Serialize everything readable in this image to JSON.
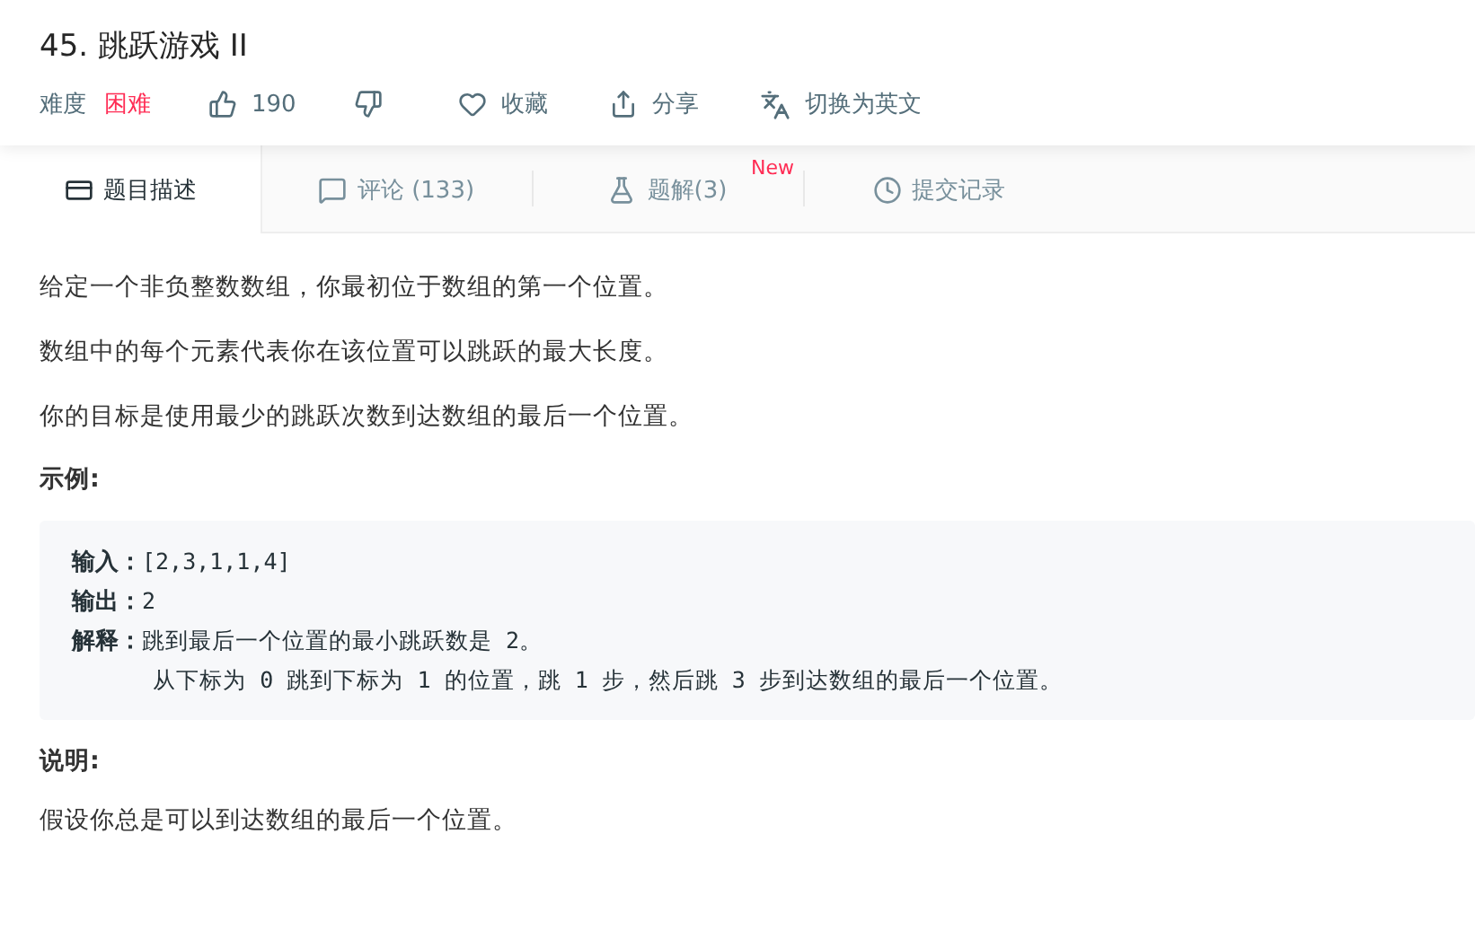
{
  "title": "45. 跳跃游戏 II",
  "meta": {
    "difficulty_label": "难度",
    "difficulty": "困难",
    "likes": "190",
    "actions": [
      {
        "kind": "favorite",
        "label": "收藏"
      },
      {
        "kind": "share",
        "label": "分享"
      },
      {
        "kind": "translate",
        "label": "切换为英文"
      }
    ]
  },
  "tabs": [
    {
      "kind": "description",
      "label": "题目描述",
      "selected": true
    },
    {
      "kind": "comments",
      "label": "评论 (133)",
      "selected": false
    },
    {
      "kind": "solutions",
      "label": "题解(3)",
      "selected": false,
      "badge": "New"
    },
    {
      "kind": "submissions",
      "label": "提交记录",
      "selected": false
    }
  ],
  "paragraphs": [
    "给定一个非负整数数组，你最初位于数组的第一个位置。",
    "数组中的每个元素代表你在该位置可以跳跃的最大长度。",
    "你的目标是使用最少的跳跃次数到达数组的最后一个位置。"
  ],
  "example_heading": "示例:",
  "example_lines": [
    "**输入：**[2,3,1,1,4]",
    "**输出：**2",
    "**解释：**跳到最后一个位置的最小跳跃数是 2。",
    "      从下标为 0 跳到下标为 1 的位置，跳 1 步，然后跳 3 步到达数组的最后一个位置。"
  ],
  "note_heading": "说明:",
  "note": "假设你总是可以到达数组的最后一个位置。"
}
